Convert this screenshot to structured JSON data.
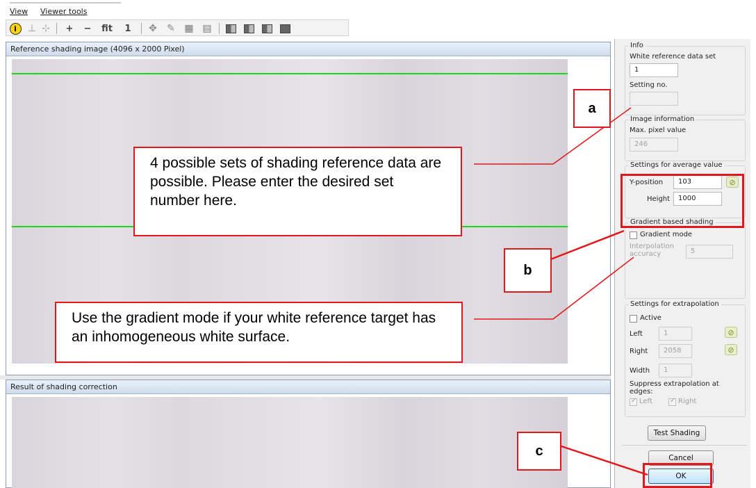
{
  "menu": {
    "view": "View",
    "viewer_tools": "Viewer tools"
  },
  "toolbar": {
    "zoom_in": "+",
    "zoom_out": "−",
    "fit": "fit",
    "one_to_one": "1"
  },
  "panes": {
    "reference_title": "Reference shading image (4096 x 2000 Pixel)",
    "result_title": "Result of shading correction"
  },
  "side": {
    "info": {
      "title": "Info",
      "white_ref_label": "White reference data set",
      "white_ref_value": "1",
      "setting_label": "Setting no.",
      "setting_value": ""
    },
    "image_info": {
      "title": "Image information",
      "max_label": "Max. pixel value",
      "max_value": "246"
    },
    "average": {
      "title": "Settings for average value",
      "ypos_label": "Y-position",
      "ypos_value": "103",
      "height_label": "Height",
      "height_value": "1000"
    },
    "gradient": {
      "title": "Gradient based shading",
      "mode_label": "Gradient mode",
      "interp_label": "Interpolation accuracy",
      "interp_value": "5"
    },
    "extrapolation": {
      "title": "Settings for extrapolation",
      "active_label": "Active",
      "left_label": "Left",
      "left_value": "1",
      "right_label": "Right",
      "right_value": "2058",
      "width_label": "Width",
      "width_value": "1",
      "suppress_label": "Suppress extrapolation at edges:",
      "edge_left_label": "Left",
      "edge_right_label": "Right"
    },
    "buttons": {
      "test": "Test Shading",
      "cancel": "Cancel",
      "ok": "OK"
    }
  },
  "annotations": {
    "a_label": "a",
    "b_label": "b",
    "c_label": "c",
    "a_text": "4 possible sets of shading reference data are possible. Please enter the desired set number here.",
    "b_text": "Use the gradient mode if your white reference target has an inhomogeneous white surface."
  },
  "colors": {
    "annotation_red": "#e3161b",
    "roi_line_green": "#1fd31f",
    "ok_button": "#bfe3f7"
  },
  "icons": [
    "info-icon",
    "select-icon",
    "crop-icon",
    "move-icon",
    "measure-icon",
    "grid-icon",
    "picker-icon",
    "view-layout-icon"
  ]
}
